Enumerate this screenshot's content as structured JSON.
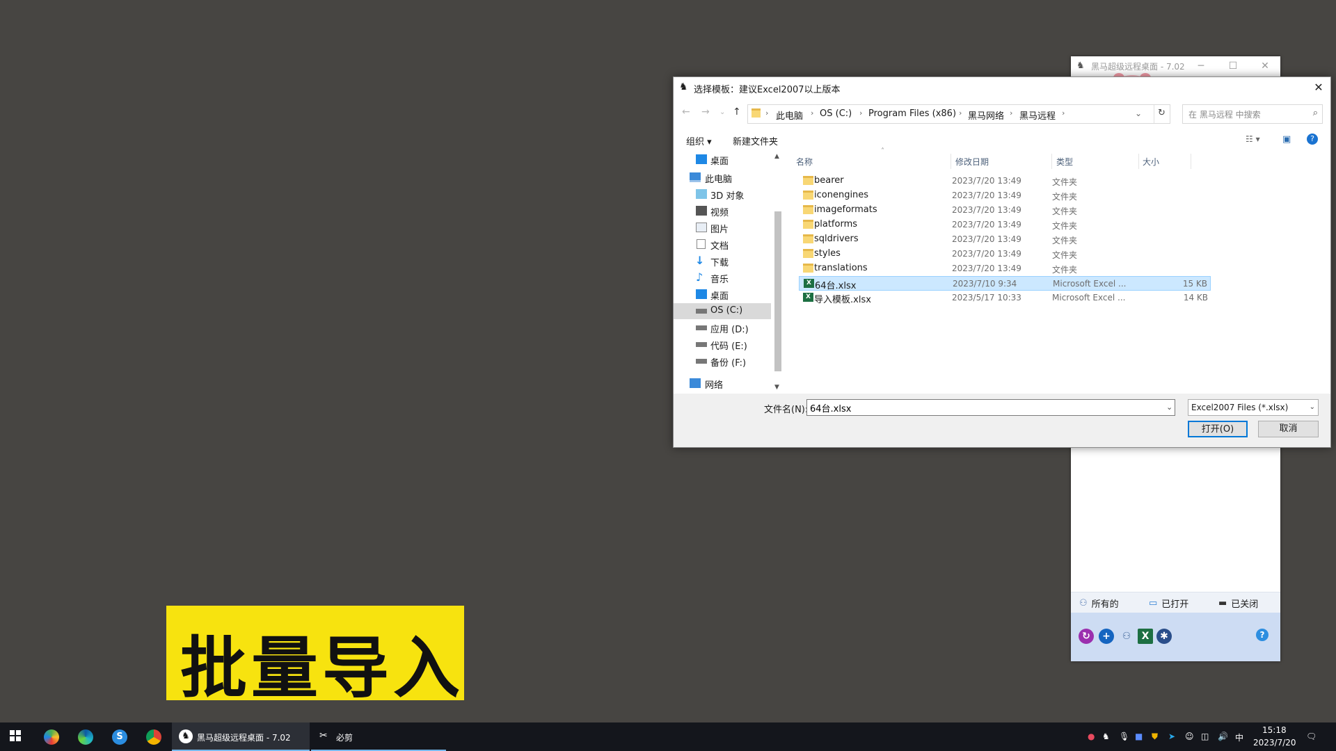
{
  "bg_app": {
    "title": "黑马超级远程桌面 - 7.02",
    "tabs": [
      "所有的",
      "已打开",
      "已关闭"
    ]
  },
  "dialog": {
    "title": "选择模板：建议Excel2007以上版本",
    "breadcrumb": [
      "此电脑",
      "OS (C:)",
      "Program Files (x86)",
      "黑马网络",
      "黑马远程"
    ],
    "search_placeholder": "在 黑马远程 中搜索",
    "commands": {
      "organize": "组织 ▾",
      "new_folder": "新建文件夹"
    },
    "nav_items": [
      {
        "label": "桌面",
        "icon": "desktop-icon"
      },
      {
        "label": "此电脑",
        "icon": "computer-icon"
      },
      {
        "label": "3D 对象",
        "icon": "3d-objects-icon"
      },
      {
        "label": "视频",
        "icon": "video-icon"
      },
      {
        "label": "图片",
        "icon": "pictures-icon"
      },
      {
        "label": "文档",
        "icon": "documents-icon"
      },
      {
        "label": "下载",
        "icon": "download-icon"
      },
      {
        "label": "音乐",
        "icon": "music-icon"
      },
      {
        "label": "桌面",
        "icon": "desktop-icon"
      },
      {
        "label": "OS (C:)",
        "icon": "drive-icon"
      },
      {
        "label": "应用 (D:)",
        "icon": "drive-icon"
      },
      {
        "label": "代码 (E:)",
        "icon": "drive-icon"
      },
      {
        "label": "备份 (F:)",
        "icon": "drive-icon"
      },
      {
        "label": "网络",
        "icon": "network-icon"
      }
    ],
    "columns": [
      "名称",
      "修改日期",
      "类型",
      "大小"
    ],
    "files": [
      {
        "name": "bearer",
        "date": "2023/7/20 13:49",
        "type": "文件夹",
        "size": "",
        "kind": "folder"
      },
      {
        "name": "iconengines",
        "date": "2023/7/20 13:49",
        "type": "文件夹",
        "size": "",
        "kind": "folder"
      },
      {
        "name": "imageformats",
        "date": "2023/7/20 13:49",
        "type": "文件夹",
        "size": "",
        "kind": "folder"
      },
      {
        "name": "platforms",
        "date": "2023/7/20 13:49",
        "type": "文件夹",
        "size": "",
        "kind": "folder"
      },
      {
        "name": "sqldrivers",
        "date": "2023/7/20 13:49",
        "type": "文件夹",
        "size": "",
        "kind": "folder"
      },
      {
        "name": "styles",
        "date": "2023/7/20 13:49",
        "type": "文件夹",
        "size": "",
        "kind": "folder"
      },
      {
        "name": "translations",
        "date": "2023/7/20 13:49",
        "type": "文件夹",
        "size": "",
        "kind": "folder"
      },
      {
        "name": "64台.xlsx",
        "date": "2023/7/10 9:34",
        "type": "Microsoft Excel ...",
        "size": "15 KB",
        "kind": "excel",
        "selected": true
      },
      {
        "name": "导入模板.xlsx",
        "date": "2023/5/17 10:33",
        "type": "Microsoft Excel ...",
        "size": "14 KB",
        "kind": "excel"
      }
    ],
    "filename_label": "文件名(N):",
    "filename_value": "64台.xlsx",
    "filter_value": "Excel2007 Files (*.xlsx)",
    "open_label": "打开(O)",
    "cancel_label": "取消"
  },
  "caption": "批量导入",
  "taskbar": {
    "apps": [
      "黑马超级远程桌面 - 7.02",
      "必剪"
    ],
    "time": "15:18",
    "date": "2023/7/20",
    "ime": "中"
  },
  "colors": {
    "desktop": "#474542",
    "caption_bg": "#f7e30f",
    "selection": "#cce8ff",
    "accent": "#0078d7",
    "taskbar": "#14161c"
  }
}
